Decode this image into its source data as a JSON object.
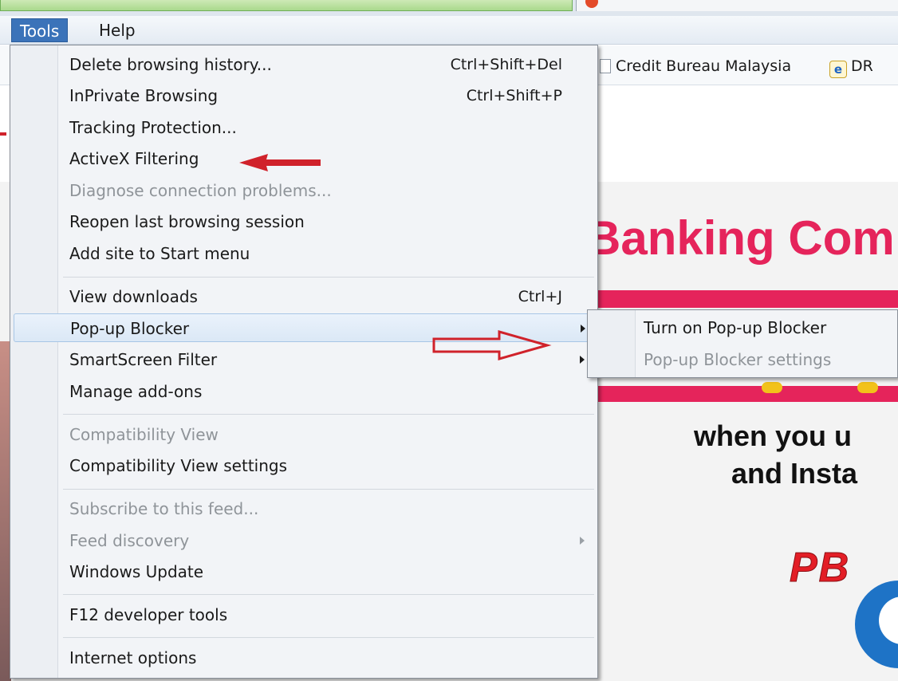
{
  "menubar": {
    "items": [
      {
        "label": "Tools",
        "active": true
      },
      {
        "label": "Help",
        "active": false
      }
    ]
  },
  "favorites": {
    "items": [
      {
        "label": "Credit Bureau Malaysia",
        "icon": "page-icon"
      },
      {
        "label": "DR",
        "icon": "ie-icon"
      }
    ]
  },
  "tools_menu": {
    "items": [
      {
        "label": "Delete browsing history...",
        "shortcut": "Ctrl+Shift+Del"
      },
      {
        "label": "InPrivate Browsing",
        "shortcut": "Ctrl+Shift+P"
      },
      {
        "label": "Tracking Protection..."
      },
      {
        "label": "ActiveX Filtering"
      },
      {
        "label": "Diagnose connection problems...",
        "disabled": true
      },
      {
        "label": "Reopen last browsing session"
      },
      {
        "label": "Add site to Start menu"
      },
      {
        "label": "View downloads",
        "shortcut": "Ctrl+J"
      },
      {
        "label": "Pop-up Blocker",
        "submenu": true,
        "highlighted": true
      },
      {
        "label": "SmartScreen Filter",
        "submenu": true
      },
      {
        "label": "Manage add-ons"
      },
      {
        "label": "Compatibility View",
        "disabled": true
      },
      {
        "label": "Compatibility View settings"
      },
      {
        "label": "Subscribe to this feed...",
        "disabled": true
      },
      {
        "label": "Feed discovery",
        "disabled": true,
        "submenu": true
      },
      {
        "label": "Windows Update"
      },
      {
        "label": "F12 developer tools"
      },
      {
        "label": "Internet options"
      }
    ]
  },
  "popup_submenu": {
    "items": [
      {
        "label": "Turn on Pop-up Blocker"
      },
      {
        "label": "Pop-up Blocker settings",
        "disabled": true
      }
    ]
  },
  "page": {
    "hero_title": "Banking Com",
    "hero_line1": "when you u",
    "hero_line2": "and Insta",
    "logo_text": "PB"
  },
  "colors": {
    "accent": "#3b73b9",
    "hero_pink": "#e5245b",
    "annotation_red": "#d0222b"
  }
}
